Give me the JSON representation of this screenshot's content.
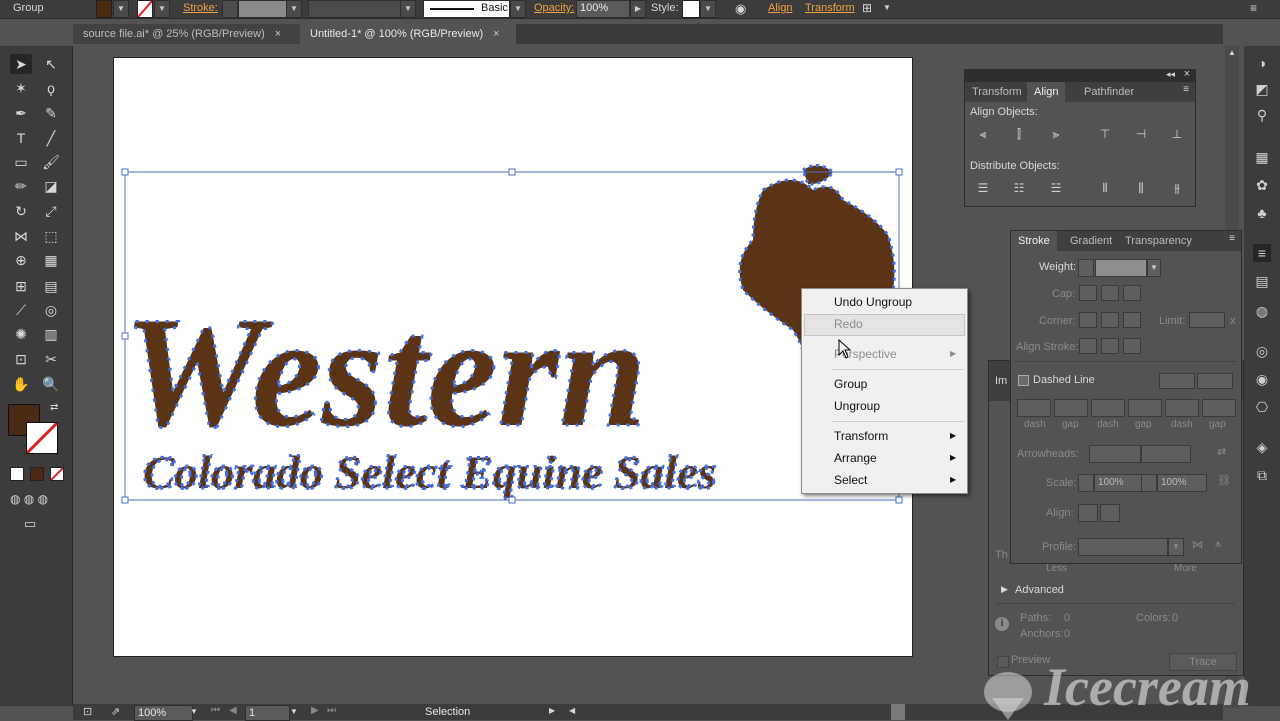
{
  "control_bar": {
    "selection_type": "Group",
    "stroke_label": "Stroke:",
    "brush_label": "Basic",
    "opacity_label": "Opacity:",
    "opacity_value": "100%",
    "style_label": "Style:",
    "align_label": "Align",
    "transform_label": "Transform"
  },
  "tabs": [
    {
      "label": "source file.ai* @ 25% (RGB/Preview)",
      "close": "×",
      "active": false
    },
    {
      "label": "Untitled-1* @ 100% (RGB/Preview)",
      "close": "×",
      "active": true
    }
  ],
  "colors": {
    "fill": "#4a2a12",
    "logo_brown": "#5a3415",
    "anchor_blue": "#3f6fe8",
    "accent_orange": "#f0a040"
  },
  "artwork": {
    "main_word": "Western",
    "tagline": "Colorado Select Equine Sales"
  },
  "align_panel": {
    "tabs": [
      "Transform",
      "Align",
      "Pathfinder"
    ],
    "active_tab": "Align",
    "align_objects_label": "Align Objects:",
    "distribute_objects_label": "Distribute Objects:"
  },
  "stroke_panel": {
    "tabs": [
      "Stroke",
      "Gradient",
      "Transparency"
    ],
    "active_tab": "Stroke",
    "weight_label": "Weight:",
    "cap_label": "Cap:",
    "corner_label": "Corner:",
    "limit_label": "Limit:",
    "limit_unit": "x",
    "align_stroke_label": "Align Stroke:",
    "dashed_line_label": "Dashed Line",
    "dash_labels": [
      "dash",
      "gap",
      "dash",
      "gap",
      "dash",
      "gap"
    ],
    "arrowheads_label": "Arrowheads:",
    "scale_label": "Scale:",
    "scale_values": [
      "100%",
      "100%"
    ],
    "align_label": "Align:",
    "profile_label": "Profile:"
  },
  "trace_panel": {
    "tab_stub": "Im",
    "threshold_stub": "Th",
    "less_label": "Less",
    "more_label": "More",
    "advanced_label": "Advanced",
    "paths_label": "Paths:",
    "paths_value": "0",
    "colors_label": "Colors:",
    "colors_value": "0",
    "anchors_label": "Anchors:",
    "anchors_value": "0",
    "preview_label": "Preview",
    "trace_button": "Trace"
  },
  "context_menu": {
    "items": [
      {
        "label": "Undo Ungroup",
        "enabled": true,
        "submenu": false
      },
      {
        "label": "Redo",
        "enabled": false,
        "submenu": false
      },
      {
        "label": "Perspective",
        "enabled": false,
        "submenu": true
      },
      {
        "label": "Group",
        "enabled": true,
        "submenu": false
      },
      {
        "label": "Ungroup",
        "enabled": true,
        "submenu": false
      },
      {
        "label": "Transform",
        "enabled": true,
        "submenu": true
      },
      {
        "label": "Arrange",
        "enabled": true,
        "submenu": true
      },
      {
        "label": "Select",
        "enabled": true,
        "submenu": true
      }
    ]
  },
  "status_bar": {
    "zoom": "100%",
    "page": "1",
    "tool": "Selection"
  },
  "watermark": "Icecream"
}
